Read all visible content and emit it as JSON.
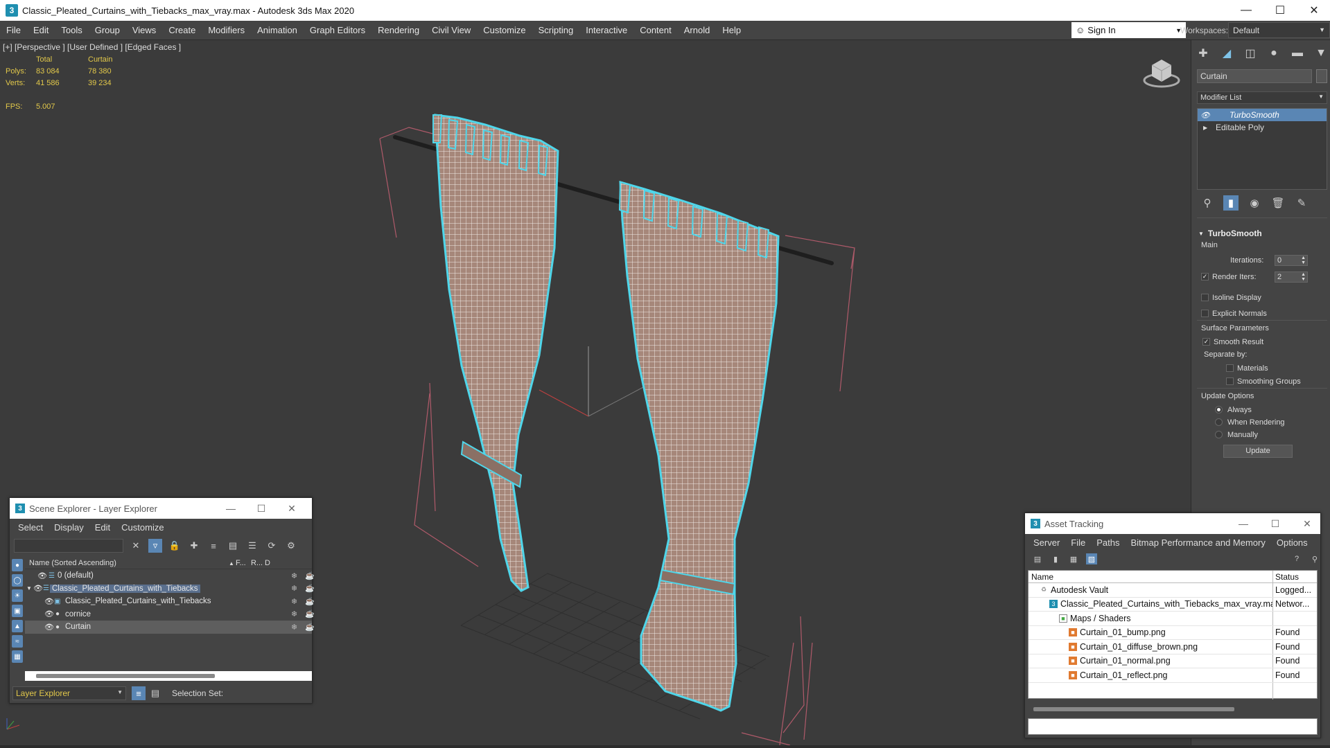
{
  "window": {
    "title": "Classic_Pleated_Curtains_with_Tiebacks_max_vray.max - Autodesk 3ds Max 2020",
    "app_icon": "3"
  },
  "menu": [
    "File",
    "Edit",
    "Tools",
    "Group",
    "Views",
    "Create",
    "Modifiers",
    "Animation",
    "Graph Editors",
    "Rendering",
    "Civil View",
    "Customize",
    "Scripting",
    "Interactive",
    "Content",
    "Arnold",
    "Help"
  ],
  "signin": {
    "label": "Sign In"
  },
  "workspaces": {
    "label": "Workspaces:",
    "value": "Default"
  },
  "viewport": {
    "label": "[+] [Perspective ] [User Defined ] [Edged Faces ]",
    "stats": {
      "col_total": "Total",
      "col_curtain": "Curtain",
      "polys_label": "Polys:",
      "polys_total": "83 084",
      "polys_curtain": "78 380",
      "verts_label": "Verts:",
      "verts_total": "41 586",
      "verts_curtain": "39 234",
      "fps_label": "FPS:",
      "fps_value": "5.007"
    },
    "wire_color": "#e9e2de",
    "fabric_color": "#a6877a",
    "selection_color": "#4fd6ea"
  },
  "command_panel": {
    "object_name": "Curtain",
    "modifier_list": "Modifier List",
    "stack": [
      {
        "label": "TurboSmooth",
        "selected": true
      },
      {
        "label": "Editable Poly",
        "selected": false
      }
    ],
    "rollout": {
      "title": "TurboSmooth",
      "main": "Main",
      "iterations_label": "Iterations:",
      "iterations_value": "0",
      "render_iters_label": "Render Iters:",
      "render_iters_value": "2",
      "isoline": "Isoline Display",
      "explicit_normals": "Explicit Normals",
      "surface_params": "Surface Parameters",
      "smooth_result": "Smooth Result",
      "separate_by": "Separate by:",
      "materials": "Materials",
      "smoothing_groups": "Smoothing Groups",
      "update_options": "Update Options",
      "always": "Always",
      "when_rendering": "When Rendering",
      "manually": "Manually",
      "update_button": "Update"
    }
  },
  "scene_explorer": {
    "title": "Scene Explorer - Layer Explorer",
    "menu": [
      "Select",
      "Display",
      "Edit",
      "Customize"
    ],
    "columns": {
      "name": "Name (Sorted Ascending)",
      "frozen": "F...",
      "render": "R...",
      "extra": "D"
    },
    "rows": [
      {
        "name": "0 (default)",
        "indent": 1,
        "highlight": false,
        "selected": false
      },
      {
        "name": "Classic_Pleated_Curtains_with_Tiebacks",
        "indent": 0,
        "highlight": true,
        "selected": false
      },
      {
        "name": "Classic_Pleated_Curtains_with_Tiebacks",
        "indent": 2,
        "highlight": false,
        "selected": false
      },
      {
        "name": "cornice",
        "indent": 2,
        "highlight": false,
        "selected": false
      },
      {
        "name": "Curtain",
        "indent": 2,
        "highlight": false,
        "selected": true
      }
    ],
    "footer_layer": "Layer Explorer",
    "selection_set": "Selection Set:"
  },
  "asset_tracking": {
    "title": "Asset Tracking",
    "menu": [
      "Server",
      "File",
      "Paths",
      "Bitmap Performance and Memory",
      "Options"
    ],
    "columns": {
      "name": "Name",
      "status": "Status"
    },
    "rows": [
      {
        "name": "Autodesk Vault",
        "status": "Logged...",
        "indent": 1,
        "icon": "vault-icon"
      },
      {
        "name": "Classic_Pleated_Curtains_with_Tiebacks_max_vray.max",
        "status": "Networ...",
        "indent": 2,
        "icon": "max-file-icon"
      },
      {
        "name": "Maps / Shaders",
        "status": "",
        "indent": 3,
        "icon": "folder-icon"
      },
      {
        "name": "Curtain_01_bump.png",
        "status": "Found",
        "indent": 4,
        "icon": "image-file-icon"
      },
      {
        "name": "Curtain_01_diffuse_brown.png",
        "status": "Found",
        "indent": 4,
        "icon": "image-file-icon"
      },
      {
        "name": "Curtain_01_normal.png",
        "status": "Found",
        "indent": 4,
        "icon": "image-file-icon"
      },
      {
        "name": "Curtain_01_reflect.png",
        "status": "Found",
        "indent": 4,
        "icon": "image-file-icon"
      }
    ]
  }
}
